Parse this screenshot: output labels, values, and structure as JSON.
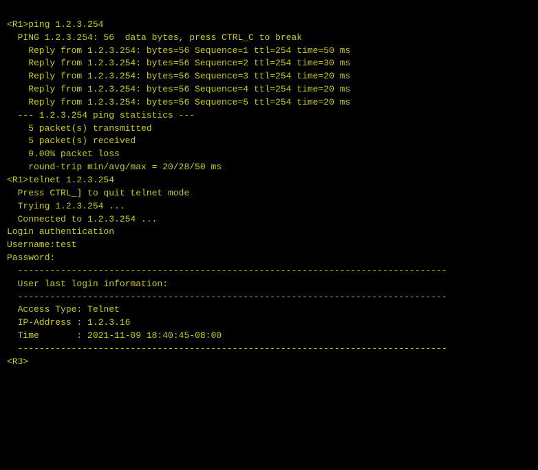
{
  "terminal": {
    "lines": [
      {
        "id": "l1",
        "text": "<R1>ping 1.2.3.254"
      },
      {
        "id": "l2",
        "text": "  PING 1.2.3.254: 56  data bytes, press CTRL_C to break"
      },
      {
        "id": "l3",
        "text": "    Reply from 1.2.3.254: bytes=56 Sequence=1 ttl=254 time=50 ms"
      },
      {
        "id": "l4",
        "text": "    Reply from 1.2.3.254: bytes=56 Sequence=2 ttl=254 time=30 ms"
      },
      {
        "id": "l5",
        "text": "    Reply from 1.2.3.254: bytes=56 Sequence=3 ttl=254 time=20 ms"
      },
      {
        "id": "l6",
        "text": "    Reply from 1.2.3.254: bytes=56 Sequence=4 ttl=254 time=20 ms"
      },
      {
        "id": "l7",
        "text": "    Reply from 1.2.3.254: bytes=56 Sequence=5 ttl=254 time=20 ms"
      },
      {
        "id": "l8",
        "text": ""
      },
      {
        "id": "l9",
        "text": "  --- 1.2.3.254 ping statistics ---"
      },
      {
        "id": "l10",
        "text": "    5 packet(s) transmitted"
      },
      {
        "id": "l11",
        "text": "    5 packet(s) received"
      },
      {
        "id": "l12",
        "text": "    0.00% packet loss"
      },
      {
        "id": "l13",
        "text": "    round-trip min/avg/max = 20/28/50 ms"
      },
      {
        "id": "l14",
        "text": ""
      },
      {
        "id": "l15",
        "text": "<R1>telnet 1.2.3.254"
      },
      {
        "id": "l16",
        "text": "  Press CTRL_] to quit telnet mode"
      },
      {
        "id": "l17",
        "text": "  Trying 1.2.3.254 ..."
      },
      {
        "id": "l18",
        "text": "  Connected to 1.2.3.254 ..."
      },
      {
        "id": "l19",
        "text": ""
      },
      {
        "id": "l20",
        "text": "Login authentication"
      },
      {
        "id": "l21",
        "text": ""
      },
      {
        "id": "l22",
        "text": ""
      },
      {
        "id": "l23",
        "text": "Username:test"
      },
      {
        "id": "l24",
        "text": "Password:"
      },
      {
        "id": "l25",
        "text": "  --------------------------------------------------------------------------------"
      },
      {
        "id": "l26",
        "text": ""
      },
      {
        "id": "l27",
        "text": "  User last login information:"
      },
      {
        "id": "l28",
        "text": "  --------------------------------------------------------------------------------"
      },
      {
        "id": "l29",
        "text": "  Access Type: Telnet"
      },
      {
        "id": "l30",
        "text": "  IP-Address : 1.2.3.16"
      },
      {
        "id": "l31",
        "text": "  Time       : 2021-11-09 18:40:45-08:00"
      },
      {
        "id": "l32",
        "text": "  --------------------------------------------------------------------------------"
      },
      {
        "id": "l33",
        "text": ""
      },
      {
        "id": "l34",
        "text": "<R3>"
      }
    ]
  }
}
